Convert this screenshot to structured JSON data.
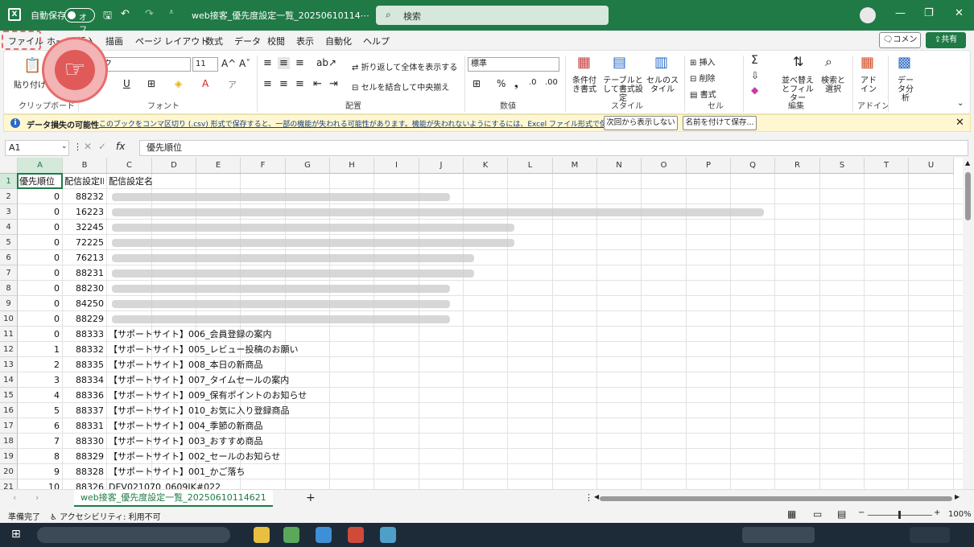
{
  "window": {
    "autosave_label": "自動保存",
    "autosave_state": "オフ",
    "doc_title": "web接客_優先度設定一覧_20250610114⋯",
    "search_placeholder": "検索"
  },
  "menu": [
    "ファイル",
    "ホーム",
    "挿入",
    "描画",
    "ページ レイアウト",
    "数式",
    "データ",
    "校閲",
    "表示",
    "自動化",
    "ヘルプ"
  ],
  "actions": {
    "comment": "コメント",
    "share": "共有"
  },
  "ribbon": {
    "paste": "貼り付け",
    "clipboard_group": "クリップボード",
    "font_name": "ク",
    "font_size": "11",
    "font_group": "フォント",
    "wrap_text": "折り返して全体を表示する",
    "merge_center": "セルを結合して中央揃え",
    "align_group": "配置",
    "number_format": "標準",
    "number_group": "数値",
    "cond_format": "条件付き書式",
    "table_format": "テーブルとして書式設定",
    "cell_style": "セルのスタイル",
    "style_group": "スタイル",
    "insert": "挿入",
    "delete": "削除",
    "format": "書式",
    "cells_group": "セル",
    "sort_filter": "並べ替えとフィルター",
    "find_select": "検索と選択",
    "edit_group": "編集",
    "addin": "アドイン",
    "addin_group": "アドイン",
    "data_analysis": "データ分析"
  },
  "infobar": {
    "title": "データ損失の可能性",
    "message": "このブックをコンマ区切り (.csv) 形式で保存すると、一部の機能が失われる可能性があります。機能が失われないようにするには、Excel ファイル形式で保存してください。",
    "dont_show": "次回から表示しない",
    "save_as": "名前を付けて保存..."
  },
  "formula_bar": {
    "name_box": "A1",
    "content": "優先順位"
  },
  "columns": [
    "A",
    "B",
    "C",
    "D",
    "E",
    "F",
    "G",
    "H",
    "I",
    "J",
    "K",
    "L",
    "M",
    "N",
    "O",
    "P",
    "Q",
    "R",
    "S",
    "T",
    "U"
  ],
  "header_row": {
    "a": "優先順位",
    "b": "配信設定ID",
    "c": "配信設定名"
  },
  "rows": [
    {
      "n": "2",
      "a": "0",
      "b": "88232",
      "c": ""
    },
    {
      "n": "3",
      "a": "0",
      "b": "16223",
      "c": ""
    },
    {
      "n": "4",
      "a": "0",
      "b": "32245",
      "c": ""
    },
    {
      "n": "5",
      "a": "0",
      "b": "72225",
      "c": ""
    },
    {
      "n": "6",
      "a": "0",
      "b": "76213",
      "c": ""
    },
    {
      "n": "7",
      "a": "0",
      "b": "88231",
      "c": ""
    },
    {
      "n": "8",
      "a": "0",
      "b": "88230",
      "c": ""
    },
    {
      "n": "9",
      "a": "0",
      "b": "84250",
      "c": ""
    },
    {
      "n": "10",
      "a": "0",
      "b": "88229",
      "c": ""
    },
    {
      "n": "11",
      "a": "0",
      "b": "88333",
      "c": "【サポートサイト】006_会員登録の案内"
    },
    {
      "n": "12",
      "a": "1",
      "b": "88332",
      "c": "【サポートサイト】005_レビュー投稿のお願い"
    },
    {
      "n": "13",
      "a": "2",
      "b": "88335",
      "c": "【サポートサイト】008_本日の新商品"
    },
    {
      "n": "14",
      "a": "3",
      "b": "88334",
      "c": "【サポートサイト】007_タイムセールの案内"
    },
    {
      "n": "15",
      "a": "4",
      "b": "88336",
      "c": "【サポートサイト】009_保有ポイントのお知らせ"
    },
    {
      "n": "16",
      "a": "5",
      "b": "88337",
      "c": "【サポートサイト】010_お気に入り登録商品"
    },
    {
      "n": "17",
      "a": "6",
      "b": "88331",
      "c": "【サポートサイト】004_季節の新商品"
    },
    {
      "n": "18",
      "a": "7",
      "b": "88330",
      "c": "【サポートサイト】003_おすすめ商品"
    },
    {
      "n": "19",
      "a": "8",
      "b": "88329",
      "c": "【サポートサイト】002_セールのお知らせ"
    },
    {
      "n": "20",
      "a": "9",
      "b": "88328",
      "c": "【サポートサイト】001_かご落ち"
    },
    {
      "n": "21",
      "a": "10",
      "b": "88326",
      "c": "DEV021070_0609JK#022"
    }
  ],
  "sheet_tab": "web接客_優先度設定一覧_20250610114621",
  "status": {
    "ready": "準備完了",
    "accessibility": "アクセシビリティ: 利用不可",
    "zoom": "100%"
  }
}
